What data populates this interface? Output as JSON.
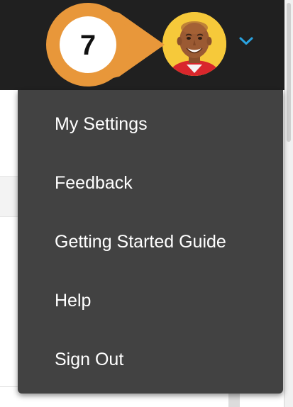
{
  "callout": {
    "number": "7"
  },
  "header": {
    "avatar_icon": "user-avatar-photo",
    "chevron_icon": "chevron-down-icon",
    "accent_color": "#2aa3e0"
  },
  "colors": {
    "topbar": "#202020",
    "menu": "#424242",
    "callout": "#e8973a",
    "avatar_bg": "#f6c93a"
  },
  "menu": {
    "items": [
      {
        "label": "My Settings"
      },
      {
        "label": "Feedback"
      },
      {
        "label": "Getting Started Guide"
      },
      {
        "label": "Help"
      },
      {
        "label": "Sign Out"
      }
    ]
  }
}
